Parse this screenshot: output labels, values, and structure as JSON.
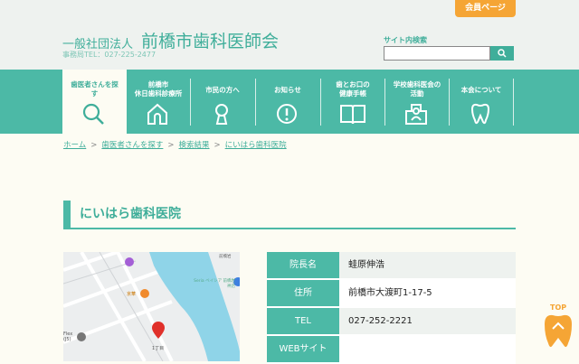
{
  "header": {
    "member_button": "会員ページ",
    "org_type": "一般社団法人",
    "org_name": "前橋市歯科医師会",
    "tel": "事務局TEL：027-225-2477",
    "search_label": "サイト内検索",
    "search_value": ""
  },
  "nav": [
    {
      "label": "歯医者さんを探す",
      "icon": "search-icon"
    },
    {
      "label": "前橋市\n休日歯科診療所",
      "icon": "home-icon"
    },
    {
      "label": "市民の方へ",
      "icon": "person-icon"
    },
    {
      "label": "お知らせ",
      "icon": "exclamation-icon"
    },
    {
      "label": "歯とお口の\n健康手帳",
      "icon": "book-icon"
    },
    {
      "label": "学校歯科医会の\n活動",
      "icon": "school-icon"
    },
    {
      "label": "本会について",
      "icon": "tooth-icon"
    }
  ],
  "breadcrumb": [
    "ホーム",
    "歯医者さんを探す",
    "検索結果",
    "にいはら歯科医院"
  ],
  "page_title": "にいはら歯科医院",
  "map": {
    "labels": [
      "Seria ベイシア 前橋岩神店",
      "京華",
      "Flex (J5)",
      "1丁目",
      "前橋岩"
    ]
  },
  "info": [
    {
      "key": "院長名",
      "value": "蛙原伸浩"
    },
    {
      "key": "住所",
      "value": "前橋市大渡町1-17-5"
    },
    {
      "key": "TEL",
      "value": "027-252-2221"
    },
    {
      "key": "WEBサイト",
      "value": ""
    }
  ],
  "top_button": "TOP",
  "colors": {
    "teal": "#4cb9a6",
    "orange": "#f5a535"
  }
}
